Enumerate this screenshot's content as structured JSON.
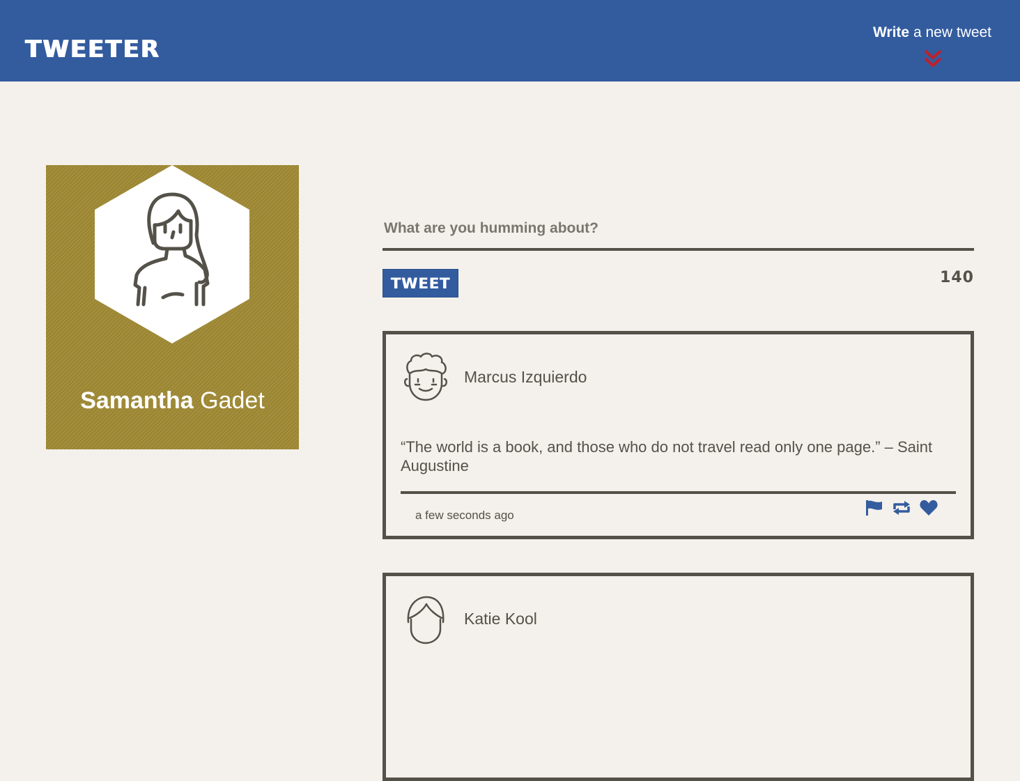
{
  "header": {
    "brand": "TWEETER",
    "compose_toggle_bold": "Write",
    "compose_toggle_rest": " a new tweet"
  },
  "colors": {
    "nav_bg": "#335c9f",
    "page_bg": "#f4f1ec",
    "profile_bg": "#a08a35",
    "accent_red": "#c0202a",
    "text_dark": "#545149"
  },
  "profile": {
    "first_name": "Samantha",
    "last_name": " Gadet",
    "avatar_icon": "woman-avatar-icon"
  },
  "compose": {
    "placeholder": "What are you humming about?",
    "value": "",
    "submit_label": "TWEET",
    "char_count": "140"
  },
  "tweets": [
    {
      "author": "Marcus Izquierdo",
      "avatar_icon": "man-curly-hair-avatar-icon",
      "body": "“The world is a book, and those who do not travel read only one page.” – Saint Augustine",
      "time": "a few seconds ago",
      "actions": [
        "flag-icon",
        "retweet-icon",
        "heart-icon"
      ]
    },
    {
      "author": "Katie Kool",
      "avatar_icon": "person-avatar-icon"
    }
  ]
}
